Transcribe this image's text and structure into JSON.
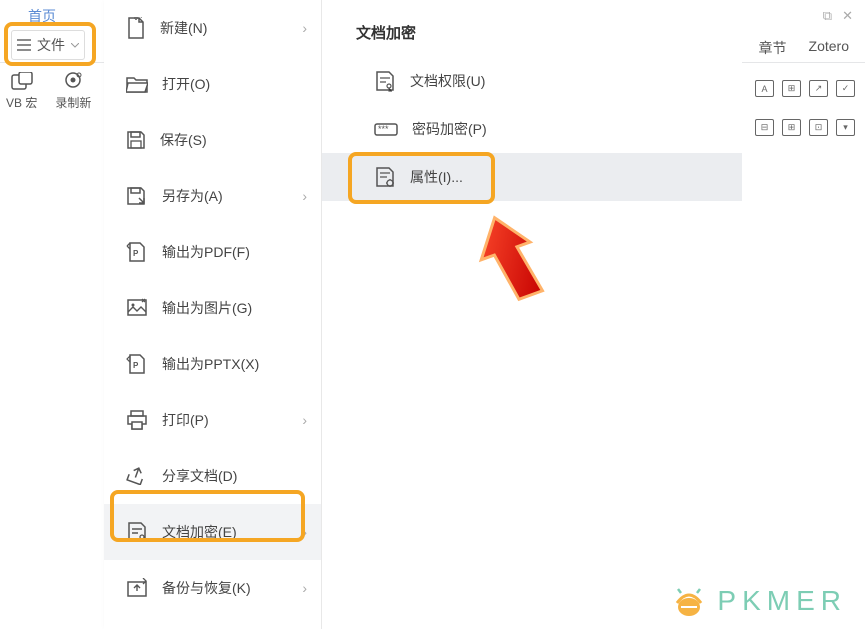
{
  "tab_home": "首页",
  "file_button": "文件",
  "toolbar": {
    "vb": "VB 宏",
    "record": "录制新"
  },
  "menu1": {
    "new": "新建(N)",
    "open": "打开(O)",
    "save": "保存(S)",
    "saveas": "另存为(A)",
    "pdf": "输出为PDF(F)",
    "image": "输出为图片(G)",
    "pptx": "输出为PPTX(X)",
    "print": "打印(P)",
    "share": "分享文档(D)",
    "encrypt": "文档加密(E)",
    "backup": "备份与恢复(K)"
  },
  "menu2": {
    "title": "文档加密",
    "perm": "文档权限(U)",
    "pwd": "密码加密(P)",
    "prop": "属性(I)..."
  },
  "right": {
    "chapter": "章节",
    "zotero": "Zotero"
  },
  "watermark": "PKMER"
}
